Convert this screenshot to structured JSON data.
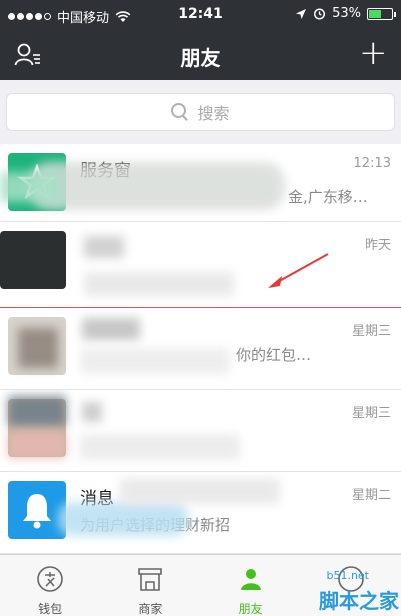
{
  "status_bar": {
    "carrier": "中国移动",
    "time": "12:41",
    "battery": "53%",
    "battery_level": 0.53
  },
  "nav": {
    "title": "朋友",
    "add_label": "+"
  },
  "search": {
    "placeholder": "搜索"
  },
  "chats": [
    {
      "name": "服务窗",
      "preview": "金,广东移…",
      "time": "12:13"
    },
    {
      "name": "",
      "preview": "",
      "time": "昨天"
    },
    {
      "name": "",
      "preview": "你的红包…",
      "time": "星期三"
    },
    {
      "name": "",
      "preview": "",
      "time": "星期三"
    },
    {
      "name": "消息",
      "preview": "为用户选择的理财新招",
      "time": "星期二"
    }
  ],
  "tabs": [
    {
      "label": "钱包"
    },
    {
      "label": "商家"
    },
    {
      "label": "朋友"
    },
    {
      "label": ""
    }
  ],
  "watermark": {
    "site": "b51.net",
    "text": "脚本之家"
  },
  "colors": {
    "header_bg": "#2e3237",
    "accent_green": "#45c01a",
    "service_green": "#1db37c",
    "notice_blue": "#1e9ae6",
    "annotation_red": "#e53935"
  }
}
